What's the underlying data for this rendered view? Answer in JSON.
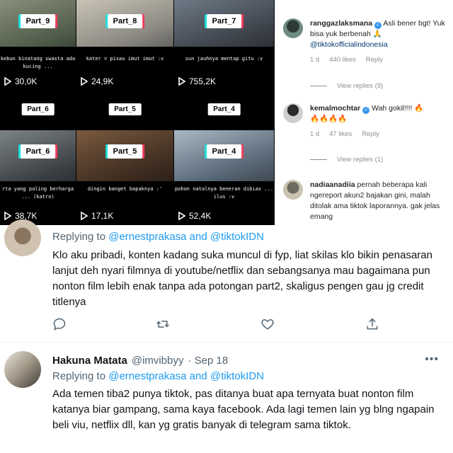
{
  "tiktok": {
    "tiles": [
      {
        "badge": "Part_9",
        "caption": "kebun binatang swasta ada kucing ...",
        "views": "30,0K",
        "style": "c1"
      },
      {
        "badge": "Part_8",
        "caption": "kater = pisau imut imut :v",
        "views": "24,9K",
        "style": "c2"
      },
      {
        "badge": "Part_7",
        "caption": "sun jauhnya mentap gitu :v",
        "views": "755,2K",
        "style": "c3"
      },
      {
        "badge": "Part_6"
      },
      {
        "badge": "Part_5"
      },
      {
        "badge": "Part_4"
      },
      {
        "badge": "Part_6",
        "caption": "rta yang paling berharga ... (katro)",
        "views": "38,7K",
        "style": "c4"
      },
      {
        "badge": "Part_5",
        "caption": "dingin banget bapaknya :'",
        "views": "17,1K",
        "style": "c5"
      },
      {
        "badge": "Part_4",
        "caption": "pohon natalnya beneran dibias ... ilus :v",
        "views": "52,4K",
        "style": "c6"
      }
    ]
  },
  "instagram": {
    "comments": [
      {
        "user": "ranggazlaksmana",
        "text": "Asli bener bgt! Yuk bisa yuk berbenah 🙏",
        "mention": "@tiktokofficialindonesia",
        "age": "1 d",
        "likes": "440 likes",
        "reply": "Reply",
        "view_replies": "View replies (9)"
      },
      {
        "user": "kemalmochtar",
        "text": "Wah gokil!!!! 🔥",
        "text2": "🔥🔥🔥🔥",
        "age": "1 d",
        "likes": "47 likes",
        "reply": "Reply",
        "view_replies": "View replies (1)"
      },
      {
        "user": "nadiaanadiia",
        "text": "pernah beberapa kali ngereport akun2 bajakan gini, malah ditolak ama tiktok laporannya. gak jelas emang"
      }
    ]
  },
  "tweets": [
    {
      "replying_prefix": "Replying to ",
      "replying_to": "@ernestprakasa and @tiktokIDN",
      "text": "Klo aku pribadi, konten kadang suka muncul di fyp, liat skilas klo bikin penasaran lanjut deh nyari filmnya di youtube/netflix dan sebangsanya mau bagaimana pun nonton film lebih enak tanpa ada potongan part2, skaligus pengen gau jg credit titlenya"
    },
    {
      "name": "Hakuna Matata",
      "handle": "@imvibbyy",
      "date": "· Sep 18",
      "replying_prefix": "Replying to ",
      "replying_to": "@ernestprakasa and @tiktokIDN",
      "text": "Ada temen tiba2 punya tiktok, pas ditanya buat apa ternyata buat nonton film katanya biar gampang, sama kaya facebook. Ada lagi temen lain yg blng ngapain beli viu, netflix dll, kan yg gratis banyak di telegram sama tiktok."
    }
  ],
  "icons": {
    "reply": "reply-icon",
    "retweet": "retweet-icon",
    "like": "like-icon",
    "share": "share-icon",
    "more": "more-icon"
  },
  "colors": {
    "twitter_link": "#1d9bf0",
    "ig_verified": "#3897f0",
    "tiktok_cyan": "#1ee3e0",
    "tiktok_red": "#f03b5a"
  }
}
